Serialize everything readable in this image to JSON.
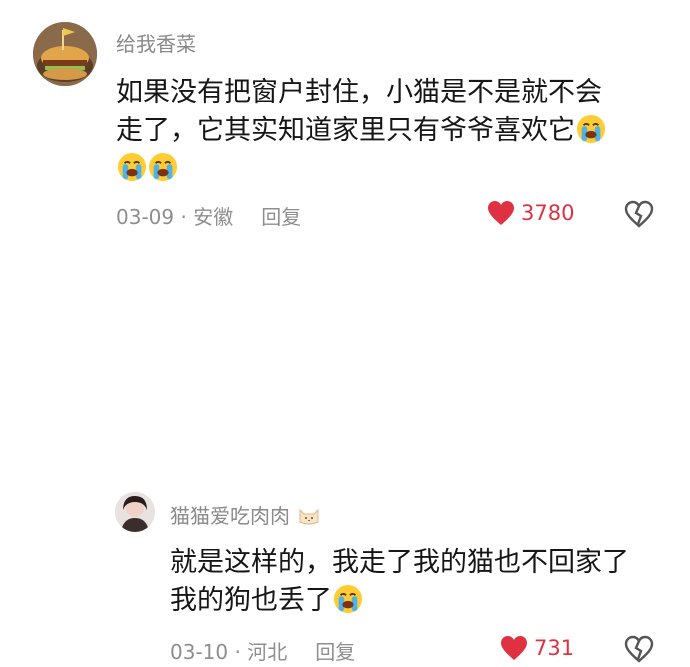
{
  "comments": [
    {
      "username": "给我香菜",
      "line1": "如果没有把窗户封住，小猫是不是就不会",
      "line2": "走了，它其实知道家里只有爷爷喜欢它",
      "line3": "",
      "date": "03-09",
      "separator": " · ",
      "location": "安徽",
      "reply_label": "回复",
      "likes": "3780",
      "accent_color": "#e03142"
    },
    {
      "username": "猫猫爱吃肉肉",
      "line1": "就是这样的，我走了我的猫也不回家了",
      "line2": "我的狗也丢了",
      "date": "03-10",
      "separator": " · ",
      "location": "河北",
      "reply_label": "回复",
      "likes": "731",
      "accent_color": "#e03142"
    }
  ],
  "icons": {
    "crying_emoji": "loudly-crying-face",
    "heart": "heart-icon",
    "broken_heart": "broken-heart-icon",
    "cat_badge": "cat-face-icon"
  }
}
